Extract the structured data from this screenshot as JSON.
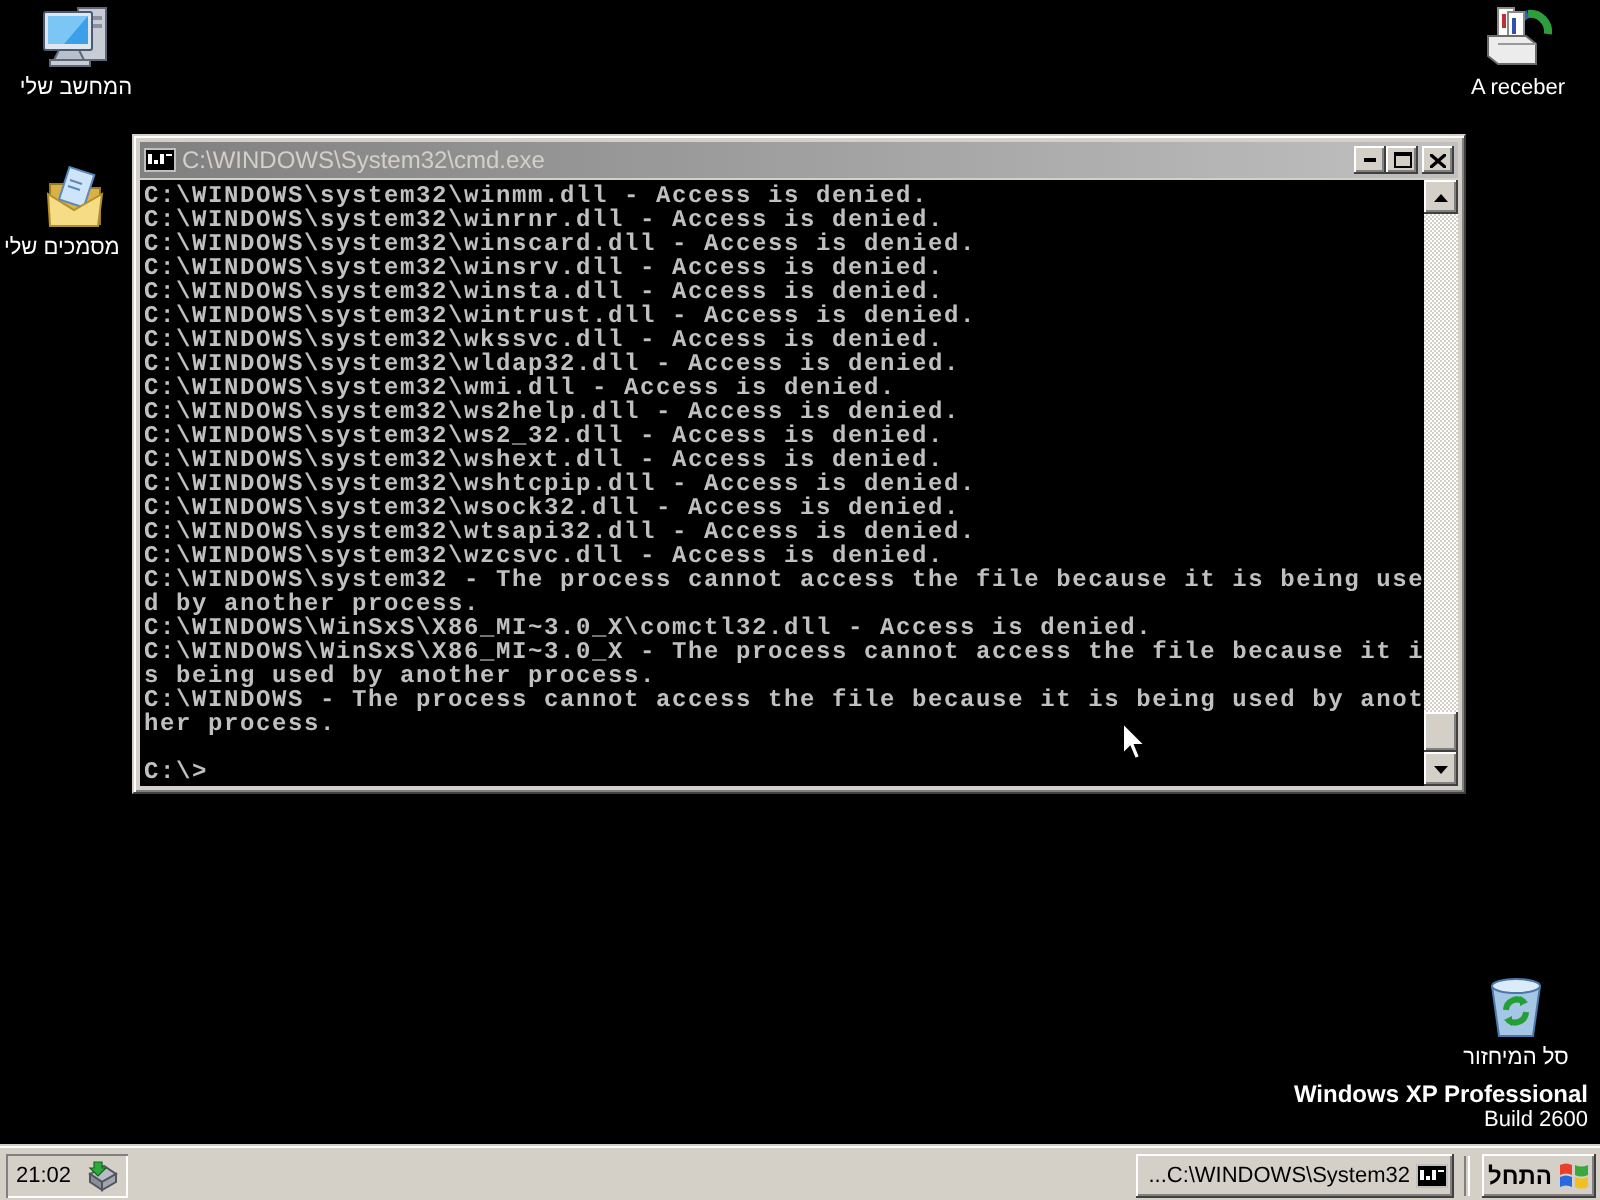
{
  "desktop_icons": [
    {
      "kind": "computer",
      "label": "המחשב שלי"
    },
    {
      "kind": "documents",
      "label": "מסמכים שלי"
    },
    {
      "kind": "inbox",
      "label": "A receber"
    },
    {
      "kind": "recycle_bin",
      "label": "סל המיחזור"
    }
  ],
  "console_window": {
    "title": "C:\\WINDOWS\\System32\\cmd.exe",
    "active": false,
    "lines": [
      "C:\\WINDOWS\\system32\\winmm.dll - Access is denied.",
      "C:\\WINDOWS\\system32\\winrnr.dll - Access is denied.",
      "C:\\WINDOWS\\system32\\winscard.dll - Access is denied.",
      "C:\\WINDOWS\\system32\\winsrv.dll - Access is denied.",
      "C:\\WINDOWS\\system32\\winsta.dll - Access is denied.",
      "C:\\WINDOWS\\system32\\wintrust.dll - Access is denied.",
      "C:\\WINDOWS\\system32\\wkssvc.dll - Access is denied.",
      "C:\\WINDOWS\\system32\\wldap32.dll - Access is denied.",
      "C:\\WINDOWS\\system32\\wmi.dll - Access is denied.",
      "C:\\WINDOWS\\system32\\ws2help.dll - Access is denied.",
      "C:\\WINDOWS\\system32\\ws2_32.dll - Access is denied.",
      "C:\\WINDOWS\\system32\\wshext.dll - Access is denied.",
      "C:\\WINDOWS\\system32\\wshtcpip.dll - Access is denied.",
      "C:\\WINDOWS\\system32\\wsock32.dll - Access is denied.",
      "C:\\WINDOWS\\system32\\wtsapi32.dll - Access is denied.",
      "C:\\WINDOWS\\system32\\wzcsvc.dll - Access is denied.",
      "C:\\WINDOWS\\system32 - The process cannot access the file because it is being use",
      "d by another process.",
      "C:\\WINDOWS\\WinSxS\\X86_MI~3.0_X\\comctl32.dll - Access is denied.",
      "C:\\WINDOWS\\WinSxS\\X86_MI~3.0_X - The process cannot access the file because it i",
      "s being used by another process.",
      "C:\\WINDOWS - The process cannot access the file because it is being used by anot",
      "her process."
    ],
    "prompt": "C:\\>"
  },
  "os_version": {
    "edition": "Windows XP Professional",
    "build": "Build 2600"
  },
  "taskbar": {
    "start_button": "התחל",
    "tasks": [
      {
        "label": "...C:\\WINDOWS\\System32",
        "selected": false
      }
    ],
    "clock": "21:02"
  }
}
